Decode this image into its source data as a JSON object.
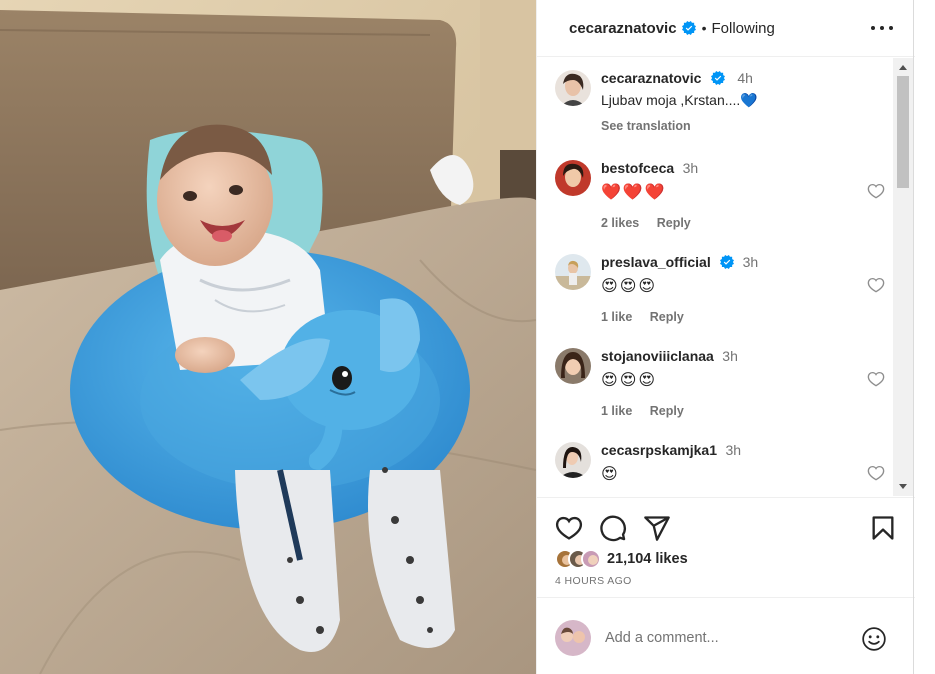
{
  "post": {
    "username": "cecaraznatovic",
    "follow_status": "Following",
    "separator": "•",
    "likes_count": "21,104 likes",
    "time_ago": "4 HOURS AGO"
  },
  "caption": {
    "username": "cecaraznatovic",
    "time": "4h",
    "text": "Ljubav moja ,Krstan....💙",
    "see_translation": "See translation"
  },
  "comments": [
    {
      "username": "bestofceca",
      "time": "3h",
      "emojis": [
        "❤️",
        "❤️",
        "❤️"
      ],
      "likes": "2 likes",
      "reply": "Reply",
      "verified": false
    },
    {
      "username": "preslava_official",
      "time": "3h",
      "emojis": [
        "😍",
        "😍",
        "😍"
      ],
      "likes": "1 like",
      "reply": "Reply",
      "verified": true
    },
    {
      "username": "stojanoviiiclanaa",
      "time": "3h",
      "emojis": [
        "😍",
        "😍",
        "😍"
      ],
      "likes": "1 like",
      "reply": "Reply",
      "verified": false
    },
    {
      "username": "cecasrpskamjka1",
      "time": "3h",
      "emojis": [
        "😍"
      ],
      "likes": "",
      "reply": "",
      "verified": false
    }
  ],
  "add_comment": {
    "placeholder": "Add a comment..."
  },
  "icons": {
    "more": "more-options-icon",
    "like": "heart-icon",
    "comment": "comment-icon",
    "share": "share-icon",
    "save": "bookmark-icon",
    "emoji": "emoji-icon",
    "verified": "verified-badge-icon"
  },
  "colors": {
    "verified": "#0095f6",
    "text": "#262626",
    "secondary": "#737373",
    "heart": "#ed4956"
  }
}
